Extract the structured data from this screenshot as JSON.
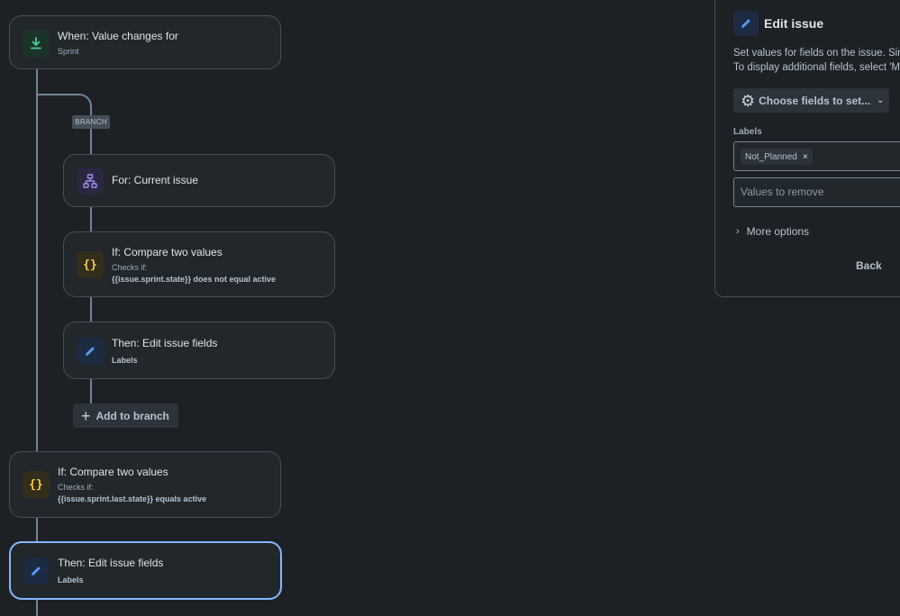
{
  "trigger": {
    "title": "When: Value changes for",
    "subtitle": "Sprint",
    "icon": "download-arrow-icon"
  },
  "branch": {
    "tag": "BRANCH",
    "for_card": {
      "title": "For: Current issue",
      "icon": "hierarchy-icon"
    },
    "if_card": {
      "title": "If: Compare two values",
      "checks_label": "Checks if:",
      "condition": "{{issue.sprint.state}} does not equal active",
      "icon": "braces-icon"
    },
    "then_card": {
      "title": "Then: Edit issue fields",
      "subtitle": "Labels",
      "icon": "pencil-icon"
    },
    "add_button": "Add to branch"
  },
  "main_if": {
    "title": "If: Compare two values",
    "checks_label": "Checks if:",
    "condition": "{{issue.sprint.last.state}} equals active",
    "icon": "braces-icon"
  },
  "main_then": {
    "title": "Then: Edit issue fields",
    "subtitle": "Labels",
    "icon": "pencil-icon"
  },
  "panel": {
    "title": "Edit issue",
    "desc_line1": "Set values for fields on the issue. Sin",
    "desc_line2": "To display additional fields, select 'M",
    "choose_button": "Choose fields to set...",
    "labels_label": "Labels",
    "label_tag": "Not_Planned",
    "remove_placeholder": "Values to remove",
    "more_options": "More options",
    "back_button": "Back"
  },
  "colors": {
    "background": "#1d2125",
    "card": "#22272b",
    "selected_border": "#85b8ff",
    "trigger_icon": "#4bce97",
    "branch_icon": "#9f8fef",
    "condition_icon": "#f5cd47",
    "action_icon": "#579dff"
  }
}
